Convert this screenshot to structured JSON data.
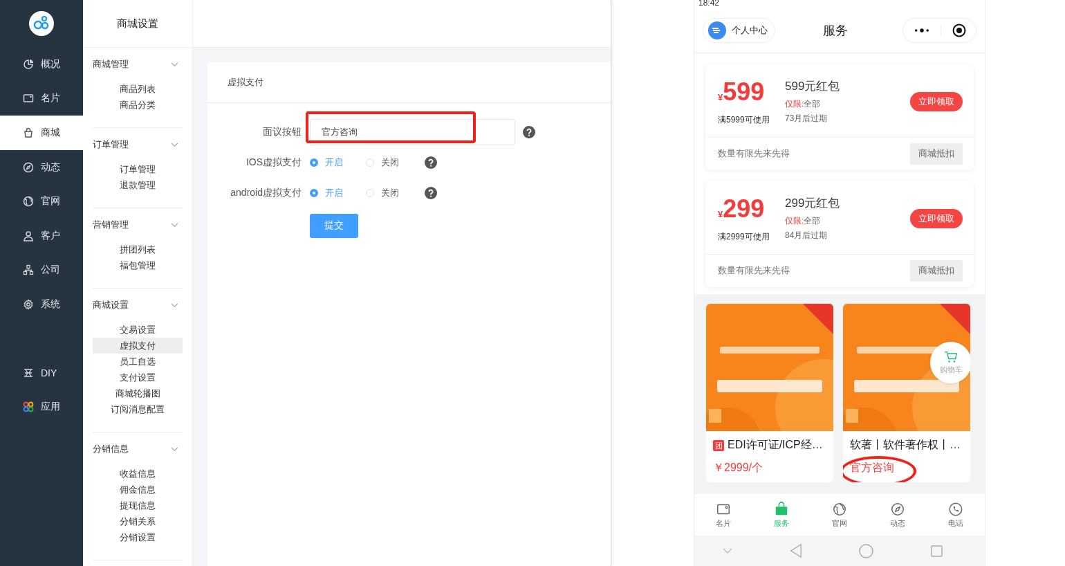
{
  "sidebar": {
    "items": [
      {
        "label": "概况",
        "selected": false
      },
      {
        "label": "名片",
        "selected": false
      },
      {
        "label": "商城",
        "selected": true
      },
      {
        "label": "动态",
        "selected": false
      },
      {
        "label": "官网",
        "selected": false
      },
      {
        "label": "客户",
        "selected": false
      },
      {
        "label": "公司",
        "selected": false
      },
      {
        "label": "系统",
        "selected": false
      }
    ],
    "extra_items": [
      {
        "label": "DIY",
        "selected": false
      },
      {
        "label": "应用",
        "selected": false
      }
    ]
  },
  "submenu": {
    "title": "商城设置",
    "groups": [
      {
        "title": "商城管理",
        "items": [
          {
            "label": "商品列表",
            "selected": false
          },
          {
            "label": "商品分类",
            "selected": false
          }
        ]
      },
      {
        "title": "订单管理",
        "items": [
          {
            "label": "订单管理",
            "selected": false
          },
          {
            "label": "退款管理",
            "selected": false
          }
        ]
      },
      {
        "title": "营销管理",
        "items": [
          {
            "label": "拼团列表",
            "selected": false
          },
          {
            "label": "福包管理",
            "selected": false
          }
        ]
      },
      {
        "title": "商城设置",
        "items": [
          {
            "label": "交易设置",
            "selected": false
          },
          {
            "label": "虚拟支付",
            "selected": true
          },
          {
            "label": "员工自选",
            "selected": false
          },
          {
            "label": "支付设置",
            "selected": false
          },
          {
            "label": "商城轮播图",
            "selected": false
          },
          {
            "label": "订阅消息配置",
            "selected": false
          }
        ]
      },
      {
        "title": "分销信息",
        "items": [
          {
            "label": "收益信息",
            "selected": false
          },
          {
            "label": "佣金信息",
            "selected": false
          },
          {
            "label": "提现信息",
            "selected": false
          },
          {
            "label": "分销关系",
            "selected": false
          },
          {
            "label": "分销设置",
            "selected": false
          }
        ]
      }
    ]
  },
  "form": {
    "title": "虚拟支付",
    "fields": [
      {
        "kind": "input",
        "label": "面议按钮",
        "value": "官方咨询",
        "highlighted": true
      },
      {
        "kind": "radio",
        "label": "IOS虚拟支付",
        "options": [
          {
            "label": "开启",
            "selected": true
          },
          {
            "label": "关闭",
            "selected": false
          }
        ]
      },
      {
        "kind": "radio",
        "label": "android虚拟支付",
        "options": [
          {
            "label": "开启",
            "selected": true
          },
          {
            "label": "关闭",
            "selected": false
          }
        ]
      }
    ],
    "submit": "提交"
  },
  "phone": {
    "status_time": "18:42",
    "profile_button": "个人中心",
    "title": "服务",
    "coupons": [
      {
        "currency": "¥",
        "amount": "599",
        "name": "599元红包",
        "limit_label": "仅限:",
        "limit": "全部",
        "condition": "满5999可使用",
        "expiry": "73月后过期",
        "claim": "立即领取",
        "note": "数量有限先来先得",
        "tag": "商城抵扣"
      },
      {
        "currency": "¥",
        "amount": "299",
        "name": "299元红包",
        "limit_label": "仅限:",
        "limit": "全部",
        "condition": "满2999可使用",
        "expiry": "84月后过期",
        "claim": "立即领取",
        "note": "数量有限先来先得",
        "tag": "商城抵扣"
      }
    ],
    "products": [
      {
        "badge": "团",
        "title": "EDI许可证/ICP经…",
        "price": "￥2999/个",
        "highlighted": false
      },
      {
        "title": "软著丨软件著作权丨…",
        "price": "官方咨询",
        "highlighted": true
      }
    ],
    "cart_button": "购物车",
    "tabs": [
      {
        "label": "名片",
        "selected": false
      },
      {
        "label": "服务",
        "selected": true
      },
      {
        "label": "官网",
        "selected": false
      },
      {
        "label": "动态",
        "selected": false
      },
      {
        "label": "电话",
        "selected": false
      }
    ]
  }
}
